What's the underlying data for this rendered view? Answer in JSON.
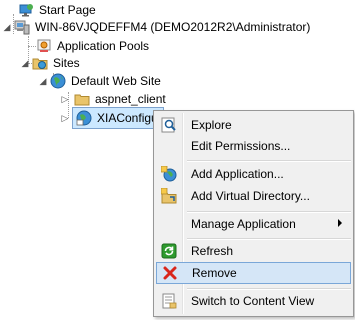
{
  "tree": {
    "start_page": "Start Page",
    "server": "WIN-86VJQDEFFM4 (DEMO2012R2\\Administrator)",
    "app_pools": "Application Pools",
    "sites": "Sites",
    "default_site": "Default Web Site",
    "aspnet_client": "aspnet_client",
    "selected_node": "XIAConfigu"
  },
  "context_menu": {
    "explore": "Explore",
    "edit_permissions": "Edit Permissions...",
    "add_application": "Add Application...",
    "add_virtual_directory": "Add Virtual Directory...",
    "manage_application": "Manage Application",
    "refresh": "Refresh",
    "remove": "Remove",
    "switch_view": "Switch to Content View"
  },
  "colors": {
    "selection_bg": "#cce8ff",
    "menu_highlight": "#d5e6f7",
    "remove_icon": "#d9261c",
    "refresh_icon": "#2e9b2e",
    "folder": "#e9c46a"
  }
}
